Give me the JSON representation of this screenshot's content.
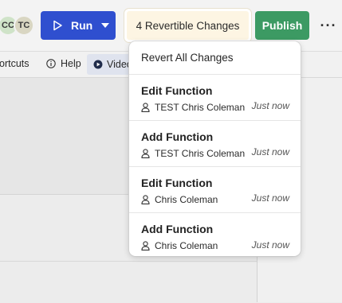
{
  "toolbar": {
    "avatars": [
      {
        "initials": "CC",
        "color": "#cfe3c8"
      },
      {
        "initials": "TC",
        "color": "#d9d6c2"
      }
    ],
    "run_label": "Run",
    "changes_label": "4 Revertible Changes",
    "publish_label": "Publish",
    "more_label": "···",
    "colors": {
      "run": "#2f4fcf",
      "publish": "#3c9a63",
      "changes_bg": "#fdf5e3"
    }
  },
  "subbar": {
    "shortcuts_label": "ortcuts",
    "help_label": "Help",
    "video_label": "Video"
  },
  "dropdown": {
    "revert_all_label": "Revert All Changes",
    "items": [
      {
        "title": "Edit Function",
        "user": "TEST Chris Coleman",
        "time": "Just now"
      },
      {
        "title": "Add Function",
        "user": "TEST Chris Coleman",
        "time": "Just now"
      },
      {
        "title": "Edit Function",
        "user": "Chris Coleman",
        "time": "Just now"
      },
      {
        "title": "Add Function",
        "user": "Chris Coleman",
        "time": "Just now"
      }
    ]
  }
}
